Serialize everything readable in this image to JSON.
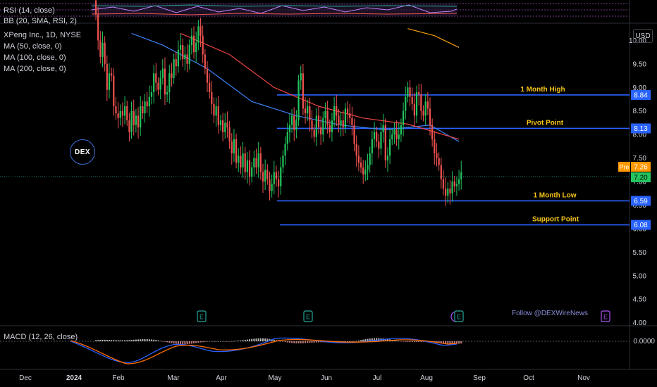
{
  "panes": {
    "rsi_label": "RSI (14, close)",
    "bb_label": "BB (20, SMA, RSI, 2)",
    "macd_label": "MACD (12, 26, close)",
    "macd_value": "0.0000"
  },
  "main_legend": {
    "symbol": "XPeng Inc., 1D, NYSE",
    "ma50": "MA (50, close, 0)",
    "ma100": "MA (100, close, 0)",
    "ma200": "MA (200, close, 0)"
  },
  "currency_button": "USD",
  "logo_text": "DEX",
  "watermark": "Follow @DEXWireNews",
  "levels": [
    {
      "name": "1 Month High",
      "value": 8.84,
      "label": "8.84"
    },
    {
      "name": "Pivot Point",
      "value": 8.13,
      "label": "8.13"
    },
    {
      "name": "1 Month Low",
      "value": 6.59,
      "label": "6.59"
    },
    {
      "name": "Support Point",
      "value": 6.08,
      "label": "6.08"
    }
  ],
  "price_tags": {
    "pre_label": "Pre",
    "pre_value": "7.26",
    "last_value": "7.20"
  },
  "earnings_marker": "E",
  "colors": {
    "up": "#26a69a",
    "down": "#ef5350",
    "up_bright": "#22c55e",
    "level": "#2962ff",
    "level_label": "#f5c518",
    "ma50": "#3b82f6",
    "ma100": "#ef4444",
    "ma200": "#f59e0b",
    "pre": "#ff9800"
  },
  "chart_data": {
    "type": "candlestick",
    "y_ticks": [
      "10.00",
      "9.50",
      "9.00",
      "8.50",
      "8.00",
      "7.50",
      "7.00",
      "6.50",
      "6.00",
      "5.50",
      "5.00",
      "4.50",
      "4.00"
    ],
    "ylim": [
      3.95,
      10.35
    ],
    "x_ticks": [
      "Dec",
      "2024",
      "Feb",
      "Mar",
      "Apr",
      "May",
      "Jun",
      "Jul",
      "Aug",
      "Sep",
      "Oct",
      "Nov"
    ],
    "closes": [
      10.55,
      10.0,
      9.65,
      9.95,
      9.5,
      8.95,
      9.3,
      9.25,
      8.6,
      8.45,
      8.35,
      8.5,
      8.4,
      8.6,
      8.3,
      8.05,
      8.5,
      8.2,
      8.4,
      8.15,
      8.6,
      8.45,
      8.7,
      8.6,
      8.8,
      8.9,
      9.3,
      9.1,
      8.95,
      9.2,
      9.4,
      8.85,
      8.9,
      9.3,
      9.2,
      9.6,
      9.45,
      9.8,
      9.9,
      9.6,
      9.7,
      9.5,
      9.9,
      10.1,
      9.75,
      9.95,
      10.3,
      10.1,
      9.7,
      9.4,
      9.1,
      8.9,
      8.65,
      8.4,
      8.6,
      8.2,
      8.3,
      8.05,
      8.25,
      8.15,
      7.85,
      7.6,
      7.9,
      7.4,
      7.55,
      7.3,
      7.6,
      7.2,
      7.45,
      7.1,
      7.3,
      7.5,
      7.3,
      7.6,
      7.2,
      7.0,
      7.25,
      7.05,
      6.8,
      6.95,
      7.2,
      7.05,
      6.9,
      7.3,
      7.55,
      7.8,
      8.05,
      8.2,
      8.4,
      8.1,
      8.3,
      9.15,
      9.3,
      8.55,
      8.45,
      8.6,
      8.3,
      8.1,
      7.95,
      8.4,
      8.15,
      8.0,
      8.35,
      8.5,
      8.2,
      8.05,
      8.3,
      8.6,
      8.4,
      8.2,
      8.3,
      8.15,
      8.55,
      8.45,
      8.35,
      8.2,
      7.8,
      7.55,
      7.4,
      7.3,
      7.15,
      7.25,
      7.35,
      7.6,
      7.9,
      8.05,
      7.85,
      7.7,
      8.05,
      8.2,
      7.45,
      7.55,
      7.9,
      8.0,
      8.1,
      7.9,
      8.0,
      8.2,
      8.5,
      8.8,
      9.0,
      8.8,
      8.65,
      8.4,
      8.9,
      8.85,
      8.5,
      8.4,
      8.7,
      8.55,
      8.2,
      7.9,
      7.6,
      7.5,
      7.35,
      7.05,
      6.85,
      6.7,
      6.85,
      6.75,
      7.0,
      6.9,
      6.95,
      7.05,
      7.2
    ],
    "series": [
      {
        "name": "MA (50, close, 0)",
        "values": [
          [
            16,
            10.15
          ],
          [
            30,
            9.9
          ],
          [
            50,
            9.4
          ],
          [
            70,
            8.7
          ],
          [
            90,
            8.4
          ],
          [
            110,
            8.2
          ],
          [
            130,
            8.1
          ],
          [
            150,
            8.2
          ],
          [
            163,
            7.85
          ]
        ]
      },
      {
        "name": "MA (100, close, 0)",
        "values": [
          [
            38,
            10.15
          ],
          [
            60,
            9.7
          ],
          [
            80,
            9.0
          ],
          [
            100,
            8.6
          ],
          [
            120,
            8.35
          ],
          [
            140,
            8.22
          ],
          [
            163,
            7.9
          ]
        ]
      },
      {
        "name": "MA (200, close, 0)",
        "values": [
          [
            140,
            10.25
          ],
          [
            152,
            10.1
          ],
          [
            163,
            9.85
          ]
        ]
      }
    ]
  }
}
